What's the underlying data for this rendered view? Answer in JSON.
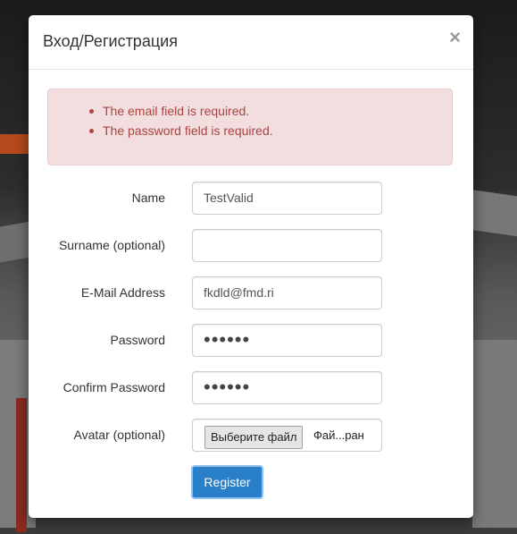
{
  "modal": {
    "title": "Вход/Регистрация",
    "close_label": "×"
  },
  "errors": [
    "The email field is required.",
    "The password field is required."
  ],
  "form": {
    "name": {
      "label": "Name",
      "value": "TestValid"
    },
    "surname": {
      "label": "Surname (optional)",
      "value": ""
    },
    "email": {
      "label": "E-Mail Address",
      "value": "fkdld@fmd.ri"
    },
    "password": {
      "label": "Password",
      "value": "••••••"
    },
    "confirm_password": {
      "label": "Confirm Password",
      "value": "••••••"
    },
    "avatar": {
      "label": "Avatar (optional)",
      "button_label": "Выберите файл",
      "file_text": "Фай...ран"
    },
    "submit_label": "Register"
  },
  "colors": {
    "alert_bg": "#f2dede",
    "alert_text": "#a94442",
    "primary": "#2a7fc9"
  }
}
